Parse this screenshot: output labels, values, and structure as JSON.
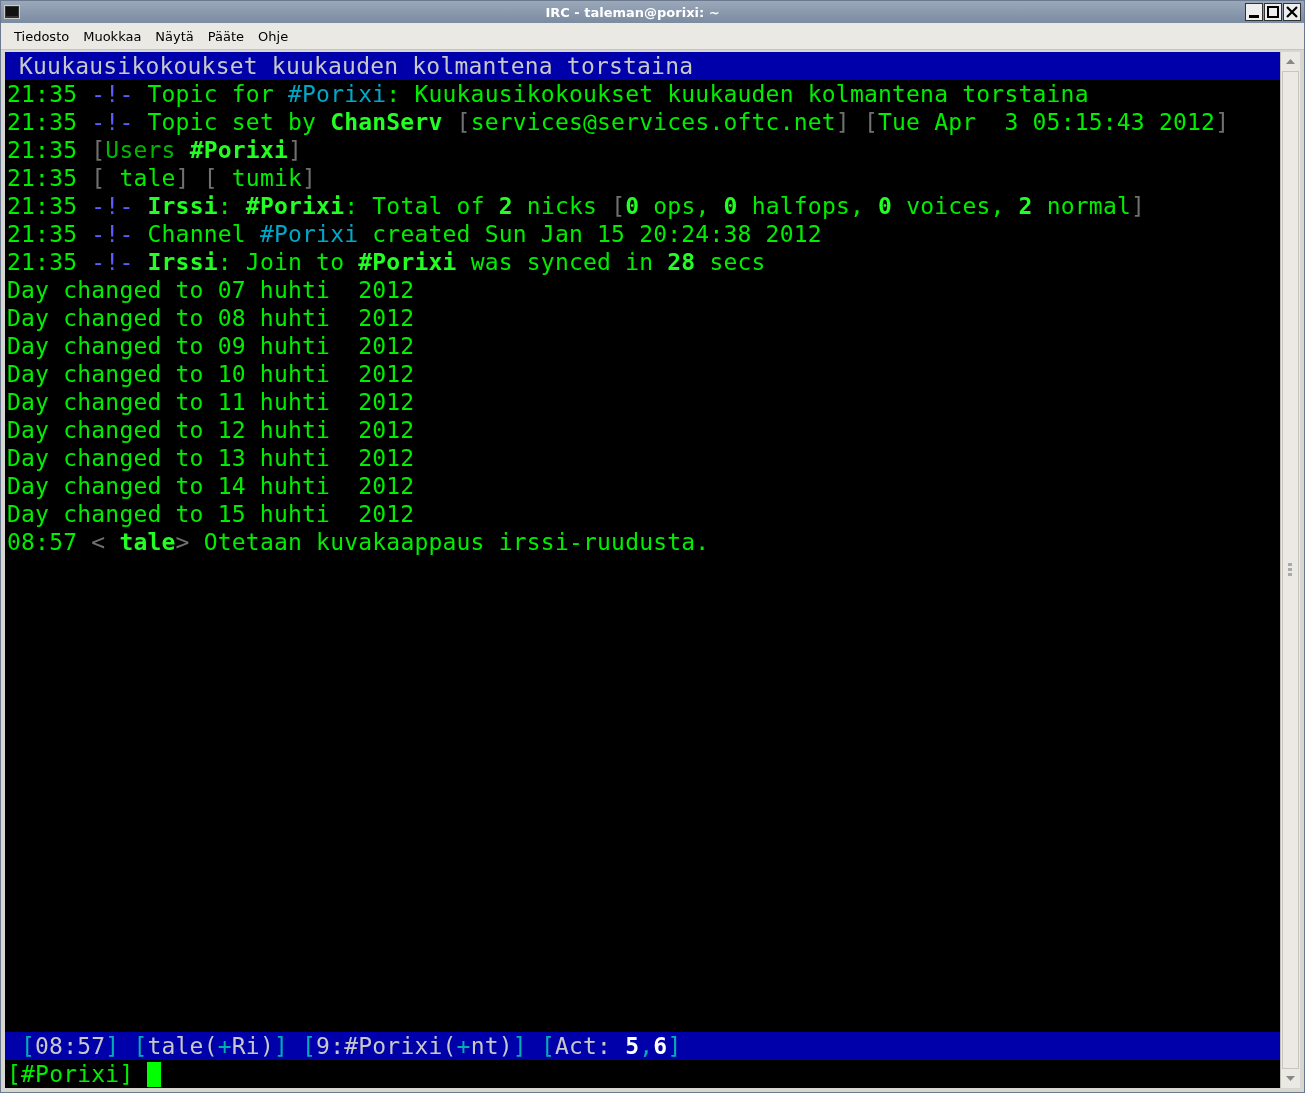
{
  "window": {
    "title": "IRC - taleman@porixi: ~"
  },
  "menu": [
    "Tiedosto",
    "Muokkaa",
    "Näytä",
    "Pääte",
    "Ohje"
  ],
  "topic_bar": "Kuukausikokoukset kuukauden kolmantena torstaina",
  "lines": [
    [
      {
        "kind": "text",
        "text": "21:35 "
      },
      {
        "kind": "blue",
        "text": "-!-"
      },
      {
        "kind": "text",
        "text": " Topic for "
      },
      {
        "kind": "cyan",
        "text": "#Porixi"
      },
      {
        "kind": "text",
        "text": ": Kuukausikokoukset kuukauden kolmantena torstaina"
      }
    ],
    [
      {
        "kind": "text",
        "text": "21:35 "
      },
      {
        "kind": "blue",
        "text": "-!-"
      },
      {
        "kind": "text",
        "text": " Topic set by "
      },
      {
        "kind": "bold",
        "text": "ChanServ"
      },
      {
        "kind": "gray",
        "text": " ["
      },
      {
        "kind": "text",
        "text": "services@services.oftc.net"
      },
      {
        "kind": "gray",
        "text": "] ["
      },
      {
        "kind": "text",
        "text": "Tue Apr  3 05:15:43 2012"
      },
      {
        "kind": "gray",
        "text": "]"
      }
    ],
    [
      {
        "kind": "text",
        "text": "21:35 "
      },
      {
        "kind": "gray",
        "text": "["
      },
      {
        "kind": "dim",
        "text": "Users "
      },
      {
        "kind": "bold",
        "text": "#Porixi"
      },
      {
        "kind": "gray",
        "text": "]"
      }
    ],
    [
      {
        "kind": "text",
        "text": "21:35 "
      },
      {
        "kind": "gray",
        "text": "["
      },
      {
        "kind": "text",
        "text": " tale"
      },
      {
        "kind": "gray",
        "text": "] ["
      },
      {
        "kind": "text",
        "text": " tumik"
      },
      {
        "kind": "gray",
        "text": "]"
      }
    ],
    [
      {
        "kind": "text",
        "text": "21:35 "
      },
      {
        "kind": "blue",
        "text": "-!-"
      },
      {
        "kind": "bold",
        "text": " Irssi"
      },
      {
        "kind": "text",
        "text": ": "
      },
      {
        "kind": "bold",
        "text": "#Porixi"
      },
      {
        "kind": "text",
        "text": ": Total of "
      },
      {
        "kind": "bold",
        "text": "2"
      },
      {
        "kind": "text",
        "text": " nicks "
      },
      {
        "kind": "gray",
        "text": "["
      },
      {
        "kind": "bold",
        "text": "0"
      },
      {
        "kind": "text",
        "text": " ops, "
      },
      {
        "kind": "bold",
        "text": "0"
      },
      {
        "kind": "text",
        "text": " halfops, "
      },
      {
        "kind": "bold",
        "text": "0"
      },
      {
        "kind": "text",
        "text": " voices, "
      },
      {
        "kind": "bold",
        "text": "2"
      },
      {
        "kind": "text",
        "text": " normal"
      },
      {
        "kind": "gray",
        "text": "]"
      }
    ],
    [
      {
        "kind": "text",
        "text": "21:35 "
      },
      {
        "kind": "blue",
        "text": "-!-"
      },
      {
        "kind": "text",
        "text": " Channel "
      },
      {
        "kind": "cyan",
        "text": "#Porixi"
      },
      {
        "kind": "text",
        "text": " created Sun Jan 15 20:24:38 2012"
      }
    ],
    [
      {
        "kind": "text",
        "text": "21:35 "
      },
      {
        "kind": "blue",
        "text": "-!-"
      },
      {
        "kind": "bold",
        "text": " Irssi"
      },
      {
        "kind": "text",
        "text": ": Join to "
      },
      {
        "kind": "bold",
        "text": "#Porixi"
      },
      {
        "kind": "text",
        "text": " was synced in "
      },
      {
        "kind": "bold",
        "text": "28"
      },
      {
        "kind": "text",
        "text": " secs"
      }
    ],
    [
      {
        "kind": "text",
        "text": "Day changed to 07 huhti  2012"
      }
    ],
    [
      {
        "kind": "text",
        "text": "Day changed to 08 huhti  2012"
      }
    ],
    [
      {
        "kind": "text",
        "text": "Day changed to 09 huhti  2012"
      }
    ],
    [
      {
        "kind": "text",
        "text": "Day changed to 10 huhti  2012"
      }
    ],
    [
      {
        "kind": "text",
        "text": "Day changed to 11 huhti  2012"
      }
    ],
    [
      {
        "kind": "text",
        "text": "Day changed to 12 huhti  2012"
      }
    ],
    [
      {
        "kind": "text",
        "text": "Day changed to 13 huhti  2012"
      }
    ],
    [
      {
        "kind": "text",
        "text": "Day changed to 14 huhti  2012"
      }
    ],
    [
      {
        "kind": "text",
        "text": "Day changed to 15 huhti  2012"
      }
    ],
    [
      {
        "kind": "text",
        "text": "08:57 "
      },
      {
        "kind": "gray",
        "text": "<"
      },
      {
        "kind": "bold",
        "text": " tale"
      },
      {
        "kind": "gray",
        "text": ">"
      },
      {
        "kind": "text",
        "text": " Otetaan kuvakaappaus irssi-ruudusta."
      }
    ]
  ],
  "status_bar": [
    {
      "kind": "bracket",
      "text": "["
    },
    {
      "kind": "text",
      "text": "08:57"
    },
    {
      "kind": "bracket",
      "text": "] ["
    },
    {
      "kind": "text",
      "text": "tale("
    },
    {
      "kind": "bracket",
      "text": "+"
    },
    {
      "kind": "text",
      "text": "Ri)"
    },
    {
      "kind": "bracket",
      "text": "] ["
    },
    {
      "kind": "text",
      "text": "9:#Porixi("
    },
    {
      "kind": "bracket",
      "text": "+"
    },
    {
      "kind": "text",
      "text": "nt)"
    },
    {
      "kind": "bracket",
      "text": "] ["
    },
    {
      "kind": "text",
      "text": "Act: "
    },
    {
      "kind": "bold",
      "text": "5"
    },
    {
      "kind": "bracket",
      "text": ","
    },
    {
      "kind": "bold",
      "text": "6"
    },
    {
      "kind": "bracket",
      "text": "]"
    }
  ],
  "prompt": "[#Porixi]"
}
